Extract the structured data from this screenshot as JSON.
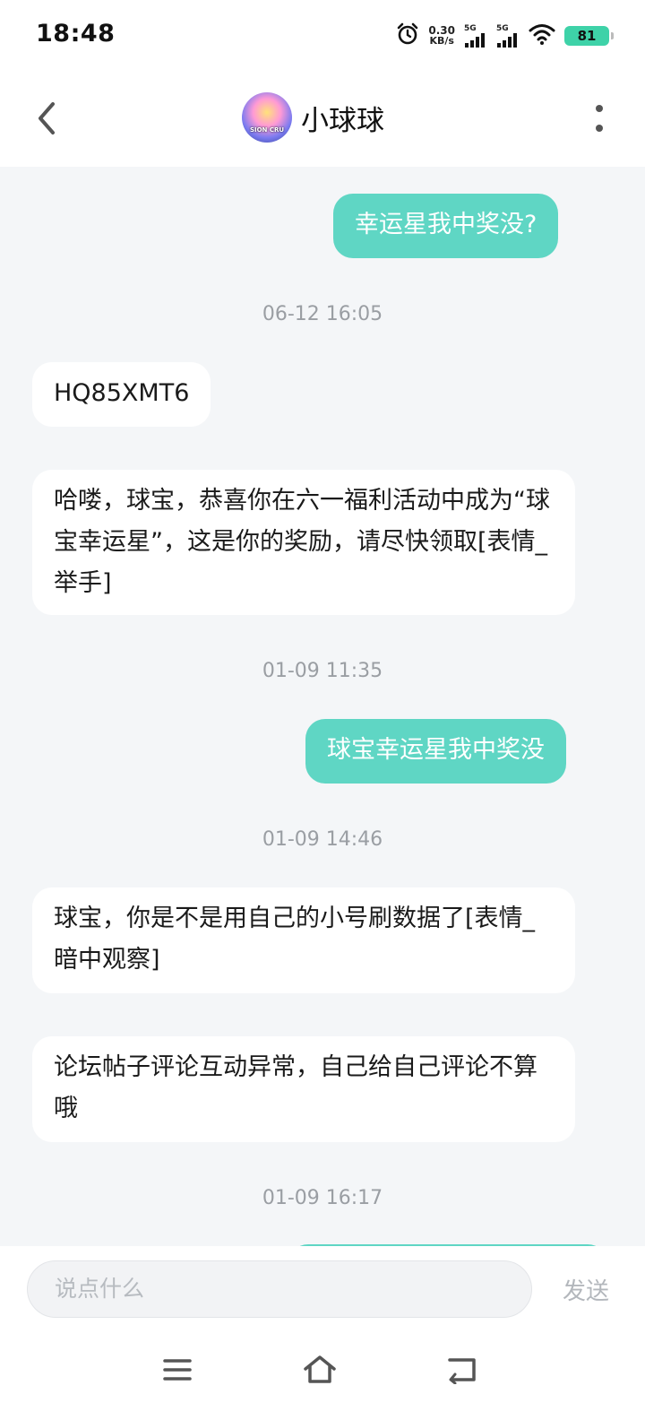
{
  "status_bar": {
    "time": "18:48",
    "net_speed_value": "0.30",
    "net_speed_unit": "KB/s",
    "sim1_label": "5G",
    "sim2_label": "5G",
    "battery": "81",
    "icons": [
      "alarm-icon",
      "signal-icon",
      "signal-icon",
      "wifi-icon",
      "battery-icon"
    ],
    "battery_color": "#3ed2a8"
  },
  "header": {
    "title": "小球球",
    "avatar_text": "SION CRU",
    "icons": [
      "back-arrow-icon",
      "more-vertical-icon"
    ]
  },
  "chat": {
    "accent_color": "#5fd6c4",
    "items": [
      {
        "type": "message",
        "direction": "out",
        "text": "幸运星我中奖没?"
      },
      {
        "type": "timestamp",
        "text": "06-12 16:05"
      },
      {
        "type": "message",
        "direction": "in",
        "text": "HQ85XMT6"
      },
      {
        "type": "message",
        "direction": "in",
        "text": "哈喽，球宝，恭喜你在六一福利活动中成为“球宝幸运星”，这是你的奖励，请尽快领取[表情_举手]"
      },
      {
        "type": "timestamp",
        "text": "01-09 11:35"
      },
      {
        "type": "message",
        "direction": "out",
        "text": "球宝幸运星我中奖没"
      },
      {
        "type": "timestamp",
        "text": "01-09 14:46"
      },
      {
        "type": "message",
        "direction": "in",
        "text": "球宝，你是不是用自己的小号刷数据了[表情_暗中观察]"
      },
      {
        "type": "message",
        "direction": "in",
        "text": "论坛帖子评论互动异常，自己给自己评论不算哦"
      },
      {
        "type": "timestamp",
        "text": "01-09 16:17"
      }
    ]
  },
  "input_bar": {
    "placeholder": "说点什么",
    "send_label": "发送"
  },
  "nav_bar": {
    "icons": [
      "menu-icon",
      "home-icon",
      "back-icon"
    ]
  }
}
